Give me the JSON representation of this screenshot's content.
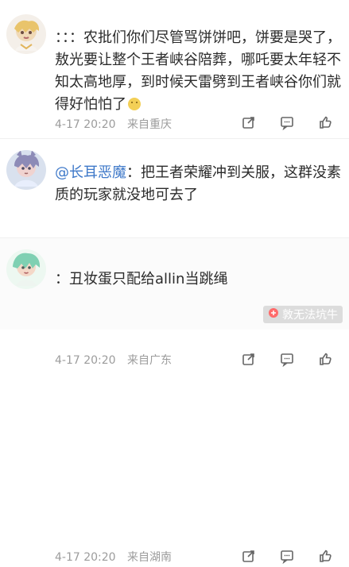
{
  "comments": [
    {
      "text": "：：：农批们你们尽管骂饼饼吧，饼要是哭了，敖光要让整个王者峡谷陪葬，哪吒要太年轻不知太高地厚，到时候天雷劈到王者峡谷你们就得好怕怕了",
      "time": "4-17 20:20",
      "location": "来自重庆"
    },
    {
      "mention": "@长耳恶魔",
      "text": "：把王者荣耀冲到关服，这群没素质的玩家就没地可去了",
      "time": "4-17 20:20",
      "location": "来自广东"
    },
    {
      "text": "：丑妆蛋只配给allin当跳绳",
      "time": "4-17 20:20",
      "location": "来自湖南"
    }
  ],
  "watermark": {
    "text": "敦无法坑牛"
  }
}
